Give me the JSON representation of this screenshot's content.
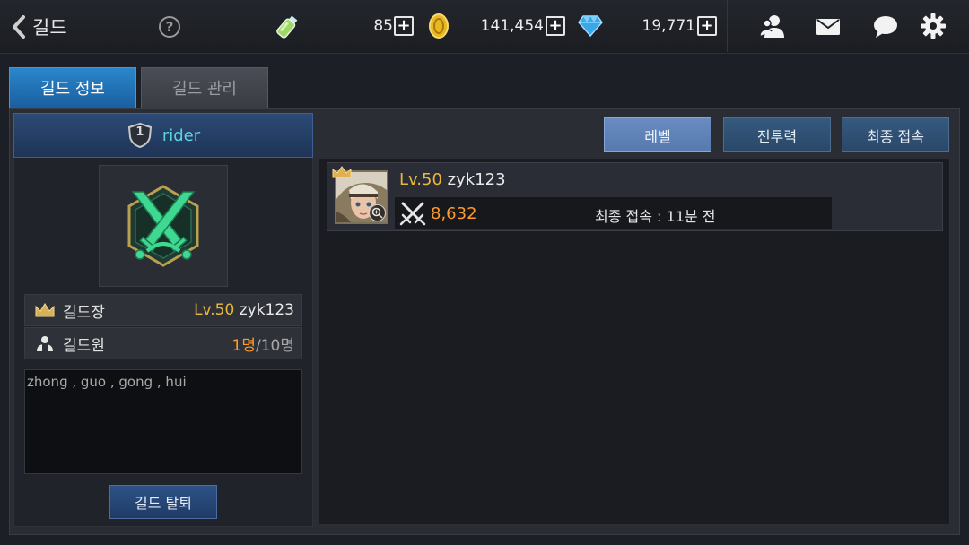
{
  "header": {
    "title": "길드",
    "help_symbol": "?",
    "stamina": {
      "value": "85",
      "icon": "potion-icon"
    },
    "gold": {
      "value": "141,454",
      "icon": "gold-coin-icon"
    },
    "gems": {
      "value": "19,771",
      "icon": "diamond-icon"
    },
    "plus_symbol": "+",
    "icons": [
      "friends-icon",
      "mail-icon",
      "chat-icon",
      "gear-icon"
    ]
  },
  "tabs": [
    {
      "label": "길드 정보",
      "active": true
    },
    {
      "label": "길드 관리",
      "active": false
    }
  ],
  "guild": {
    "rank": "1",
    "name": "rider",
    "master_label": "길드장",
    "master_level": "Lv.50",
    "master_name": "zyk123",
    "members_label": "길드원",
    "members_count": "1명",
    "members_max": "/10명",
    "description": "zhong , guo , gong , hui",
    "leave_label": "길드 탈퇴"
  },
  "sort_buttons": [
    {
      "label": "레벨",
      "active": true
    },
    {
      "label": "전투력",
      "active": false
    },
    {
      "label": "최종 접속",
      "active": false
    }
  ],
  "members": [
    {
      "level": "Lv.50",
      "name": "zyk123",
      "power": "8,632",
      "last_login": "최종 접속 : 11분 전"
    }
  ],
  "colors": {
    "accent_blue": "#1a5fa0",
    "level_gold": "#e8b83a",
    "power_orange": "#ff9a2a",
    "guild_name_cyan": "#5fd4e0"
  }
}
